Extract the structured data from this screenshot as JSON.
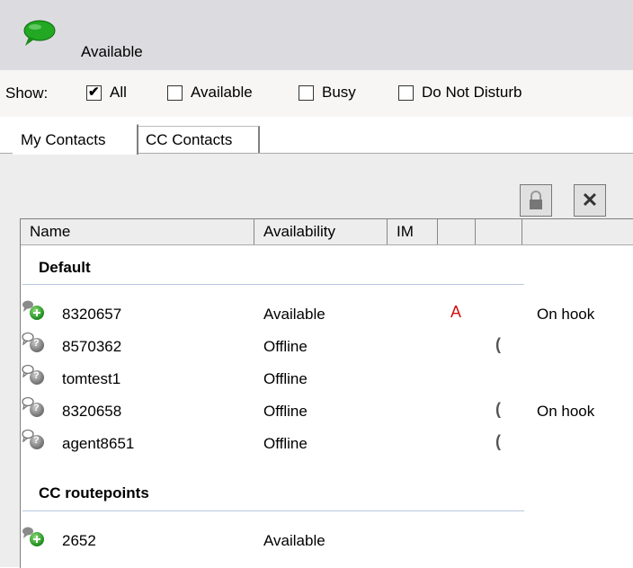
{
  "status": {
    "label": "Available",
    "icon": "chat-bubble-green-icon",
    "color": "#1f8f1f"
  },
  "filters": {
    "show_label": "Show:",
    "options": [
      {
        "label": "All",
        "checked": true
      },
      {
        "label": "Available",
        "checked": false
      },
      {
        "label": "Busy",
        "checked": false
      },
      {
        "label": "Do Not Disturb",
        "checked": false
      }
    ]
  },
  "tabs": [
    {
      "label": "My Contacts",
      "active": true
    },
    {
      "label": "CC Contacts",
      "active": false
    }
  ],
  "toolbar": {
    "lock_icon": "lock-icon",
    "close_icon": "close-icon"
  },
  "columns": [
    "Name",
    "Availability",
    "IM",
    "",
    "",
    ""
  ],
  "groups": [
    {
      "name": "Default",
      "contacts": [
        {
          "name": "8320657",
          "availability": "Available",
          "presence": "available",
          "im": "filled",
          "alert": "A",
          "phone": "",
          "hook": "On hook"
        },
        {
          "name": "8570362",
          "availability": "Offline",
          "presence": "offline",
          "im": "outline",
          "alert": "",
          "phone": "(",
          "hook": ""
        },
        {
          "name": "tomtest1",
          "availability": "Offline",
          "presence": "offline",
          "im": "outline",
          "alert": "",
          "phone": "",
          "hook": ""
        },
        {
          "name": "8320658",
          "availability": "Offline",
          "presence": "offline",
          "im": "outline",
          "alert": "",
          "phone": "(",
          "hook": "On hook"
        },
        {
          "name": "agent8651",
          "availability": "Offline",
          "presence": "offline",
          "im": "outline",
          "alert": "",
          "phone": "(",
          "hook": ""
        }
      ]
    },
    {
      "name": "CC routepoints",
      "contacts": [
        {
          "name": "2652",
          "availability": "Available",
          "presence": "available",
          "im": "filled",
          "alert": "",
          "phone": "",
          "hook": ""
        }
      ]
    }
  ]
}
